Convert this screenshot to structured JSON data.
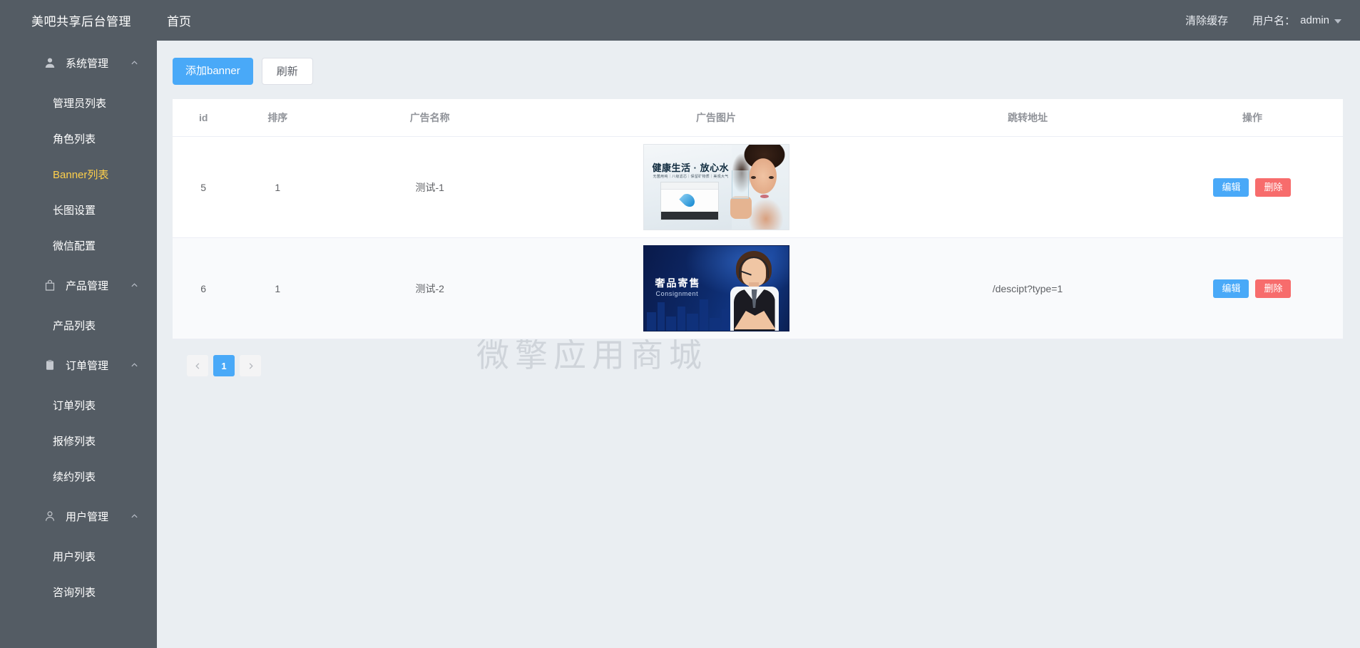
{
  "header": {
    "brand": "美吧共享后台管理",
    "nav": [
      {
        "label": "首页"
      }
    ],
    "clear_cache": "清除缓存",
    "username_label": "用户名：",
    "username": "admin"
  },
  "sidebar": {
    "groups": [
      {
        "label": "系统管理",
        "icon": "user-icon",
        "expanded": true,
        "items": [
          {
            "label": "管理员列表",
            "active": false
          },
          {
            "label": "角色列表",
            "active": false
          },
          {
            "label": "Banner列表",
            "active": true
          },
          {
            "label": "长图设置",
            "active": false
          },
          {
            "label": "微信配置",
            "active": false
          }
        ]
      },
      {
        "label": "产品管理",
        "icon": "bag-icon",
        "expanded": true,
        "items": [
          {
            "label": "产品列表",
            "active": false
          }
        ]
      },
      {
        "label": "订单管理",
        "icon": "clipboard-icon",
        "expanded": true,
        "items": [
          {
            "label": "订单列表",
            "active": false
          },
          {
            "label": "报修列表",
            "active": false
          },
          {
            "label": "续约列表",
            "active": false
          }
        ]
      },
      {
        "label": "用户管理",
        "icon": "person-icon",
        "expanded": true,
        "items": [
          {
            "label": "用户列表",
            "active": false
          },
          {
            "label": "咨询列表",
            "active": false
          }
        ]
      }
    ]
  },
  "toolbar": {
    "add_label": "添加banner",
    "refresh_label": "刷新"
  },
  "table": {
    "columns": [
      "id",
      "排序",
      "广告名称",
      "广告图片",
      "跳转地址",
      "操作"
    ],
    "rows": [
      {
        "id": "5",
        "sort": "1",
        "name": "测试-1",
        "image_kind": "water-health-banner",
        "image_title": "健康生活 · 放心水",
        "image_subtitle": "无菌用纯｜八级滤芯｜保留矿物质｜美观大气",
        "url": "",
        "edit_label": "编辑",
        "delete_label": "删除"
      },
      {
        "id": "6",
        "sort": "1",
        "name": "测试-2",
        "image_kind": "consignment-banner",
        "image_title": "奢品寄售",
        "image_subtitle": "Consignment",
        "url": "/descipt?type=1",
        "edit_label": "编辑",
        "delete_label": "删除"
      }
    ]
  },
  "watermark": "微擎应用商城",
  "pagination": {
    "prev": "prev-icon",
    "next": "next-icon",
    "pages": [
      "1"
    ],
    "current": "1"
  },
  "colors": {
    "sidebar_bg": "#545c64",
    "accent_blue": "#49a9f8",
    "danger_red": "#f76c6c",
    "active_menu": "#ffd04b",
    "page_bg": "#eaeef2"
  }
}
